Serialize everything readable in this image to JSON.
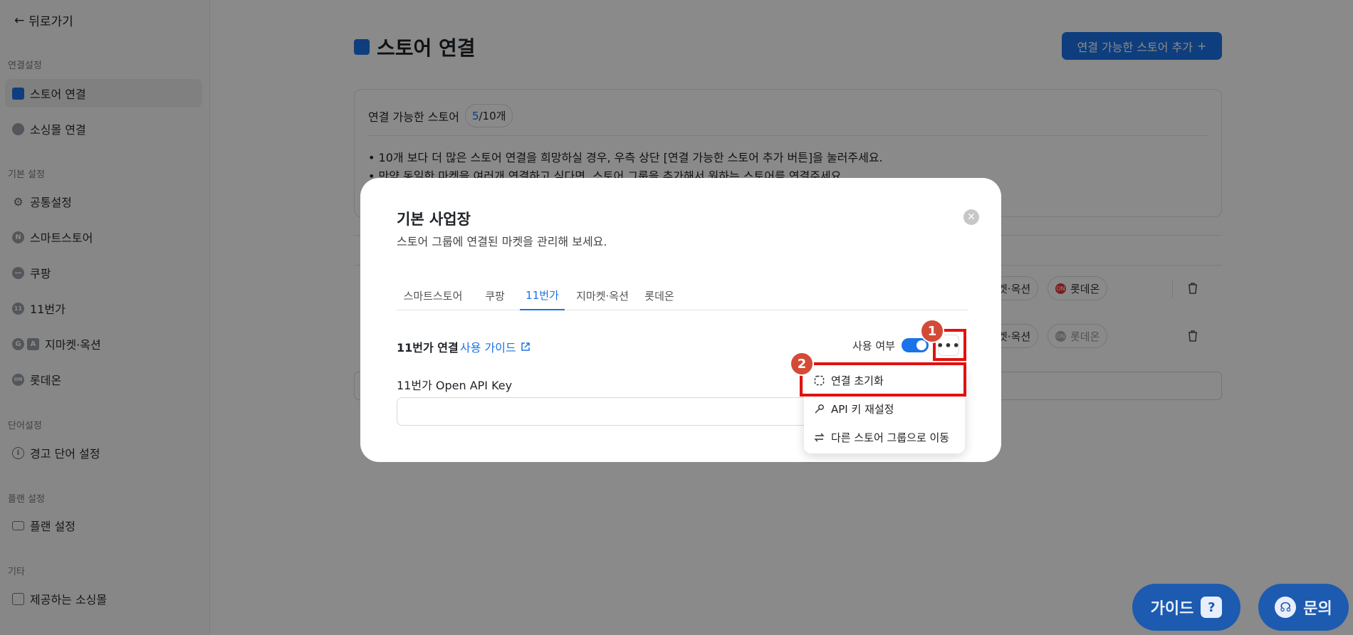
{
  "sidebar": {
    "back_label": "뒤로가기",
    "sections": [
      {
        "title": "연결설정"
      },
      {
        "title": "기본 설정"
      },
      {
        "title": "단어설정"
      },
      {
        "title": "플랜 설정"
      },
      {
        "title": "기타"
      }
    ],
    "items": [
      {
        "label": "스토어 연결",
        "icon": "store-icon",
        "active": true
      },
      {
        "label": "소싱몰 연결",
        "icon": "sourcing-icon"
      },
      {
        "label": "공통설정",
        "icon": "gear-icon"
      },
      {
        "label": "스마트스토어",
        "icon": "naver-n-icon"
      },
      {
        "label": "쿠팡",
        "icon": "coupang-icon"
      },
      {
        "label": "11번가",
        "icon": "11st-icon"
      },
      {
        "label": "지마켓·옥션",
        "icon": "gmarket-auction-icon"
      },
      {
        "label": "롯데온",
        "icon": "lotteon-icon"
      },
      {
        "label": "경고 단어 설정",
        "icon": "info-circle-icon"
      },
      {
        "label": "플랜 설정",
        "icon": "card-icon"
      },
      {
        "label": "제공하는 소싱몰",
        "icon": "building-icon"
      }
    ]
  },
  "main": {
    "title": "스토어 연결",
    "add_store_button": "연결 가능한 스토어 추가",
    "available_label": "연결 가능한 스토어",
    "count_current": "5",
    "count_total": "/10개",
    "notices": [
      "• 10개 보다 더 많은 스토어 연결을 희망하실 경우, 우측 상단 [연결 가능한 스토어 추가 버튼]을 눌러주세요.",
      "• 만약 동일한 마켓을 여러개 연결하고 싶다면, 스토어 그룹을 추가해서 원하는 스토어를 연결주세요."
    ],
    "rows": [
      {
        "chip_partial": "켓·옥션",
        "chip_lotte": "롯데온",
        "lotte_active": true
      },
      {
        "chip_partial": "켓·옥션",
        "chip_lotte": "롯데온",
        "lotte_active": false
      }
    ]
  },
  "modal": {
    "title": "기본 사업장",
    "subtitle": "스토어 그룹에 연결된 마켓을 관리해 보세요.",
    "tabs": [
      "스마트스토어",
      "쿠팡",
      "11번가",
      "지마켓·옥션",
      "롯데온"
    ],
    "active_tab": "11번가",
    "connection_label": "11번가 연결",
    "guide_link": "사용 가이드",
    "use_label": "사용 여부",
    "toggle_on": true,
    "key_label": "11번가 Open API Key",
    "menu": {
      "items": [
        "연결 초기화",
        "API 키 재설정",
        "다른 스토어 그룹으로 이동"
      ]
    },
    "annotations": [
      "1",
      "2"
    ]
  },
  "floating": {
    "guide": "가이드",
    "inquiry": "문의"
  },
  "colors": {
    "accent": "#1a73e8",
    "highlight": "#e0110f",
    "step_badge": "#d34a36",
    "fab": "#1c5bb0"
  }
}
